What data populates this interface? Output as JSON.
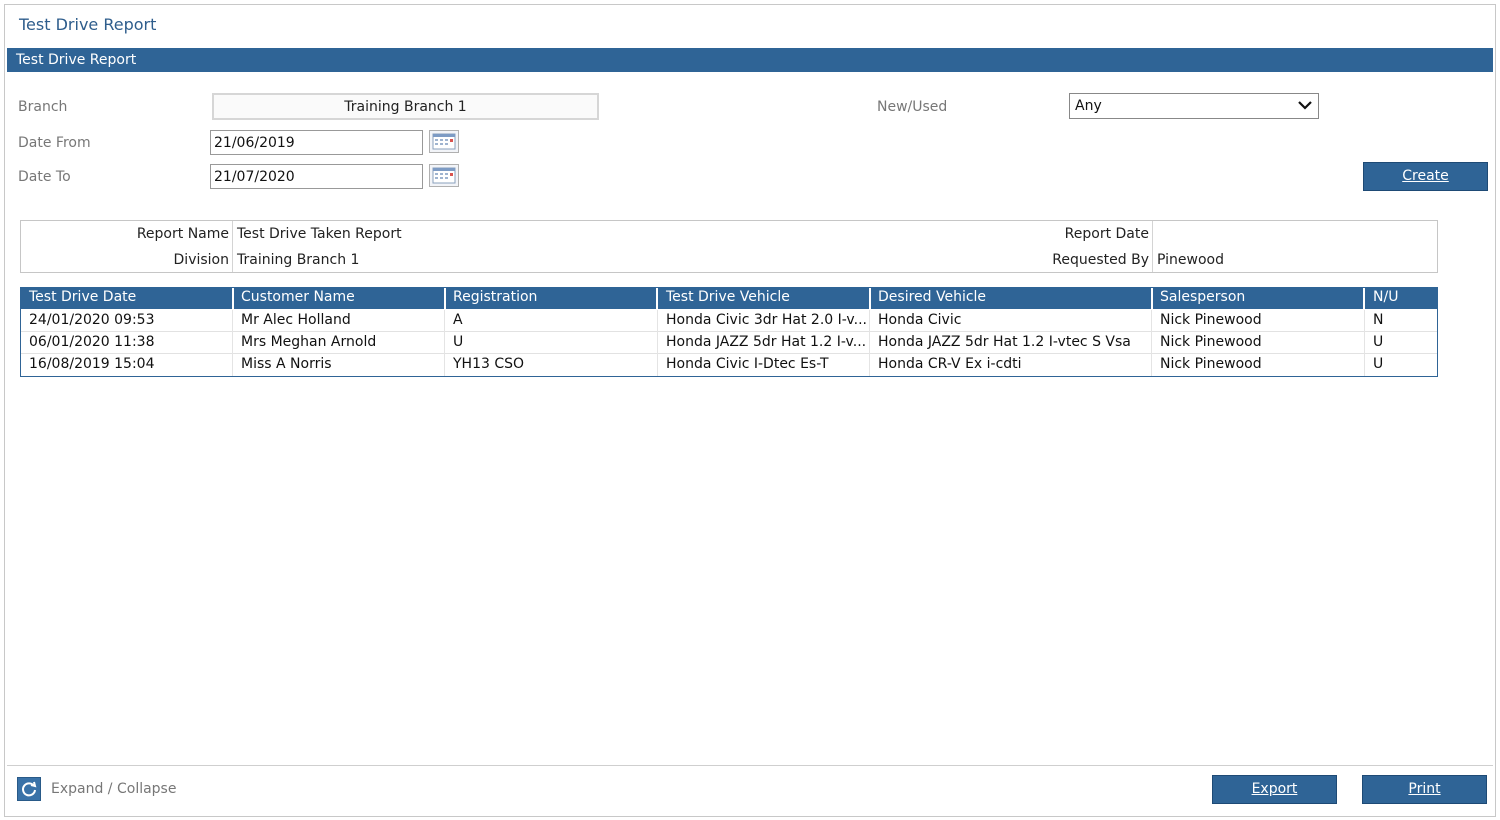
{
  "page": {
    "title": "Test Drive Report",
    "section_title": "Test Drive Report"
  },
  "filters": {
    "branch_label": "Branch",
    "branch_value": "Training Branch 1",
    "date_from_label": "Date From",
    "date_from_value": "21/06/2019",
    "date_to_label": "Date To",
    "date_to_value": "21/07/2020",
    "new_used_label": "New/Used",
    "new_used_value": "Any",
    "create_label": "Create"
  },
  "report_info": {
    "report_name_label": "Report Name",
    "report_name_value": "Test Drive Taken Report",
    "division_label": "Division",
    "division_value": "Training Branch 1",
    "report_date_label": "Report Date",
    "report_date_value": "",
    "requested_by_label": "Requested By",
    "requested_by_value": "Pinewood"
  },
  "table": {
    "columns": [
      "Test Drive Date",
      "Customer Name",
      "Registration",
      "Test Drive Vehicle",
      "Desired Vehicle",
      "Salesperson",
      "N/U"
    ],
    "rows": [
      [
        "24/01/2020 09:53",
        "Mr Alec Holland",
        "A",
        "Honda Civic 3dr Hat 2.0 I-v...",
        "Honda Civic",
        "Nick Pinewood",
        "N"
      ],
      [
        "06/01/2020 11:38",
        "Mrs Meghan Arnold",
        "U",
        "Honda JAZZ 5dr Hat 1.2 I-v...",
        "Honda JAZZ 5dr Hat 1.2 I-vtec S Vsa",
        "Nick Pinewood",
        "U"
      ],
      [
        "16/08/2019 15:04",
        "Miss A Norris",
        "YH13 CSO",
        "Honda Civic I-Dtec Es-T",
        "Honda CR-V Ex i-cdti",
        "Nick Pinewood",
        "U"
      ]
    ]
  },
  "footer": {
    "expand_label": "Expand / Collapse",
    "export_label": "Export",
    "print_label": "Print"
  },
  "colors": {
    "accent": "#2f6496",
    "title_text": "#2e5d8c"
  },
  "icons": {
    "calendar": "calendar-icon",
    "refresh": "refresh-icon",
    "dropdown": "chevron-down-icon"
  }
}
